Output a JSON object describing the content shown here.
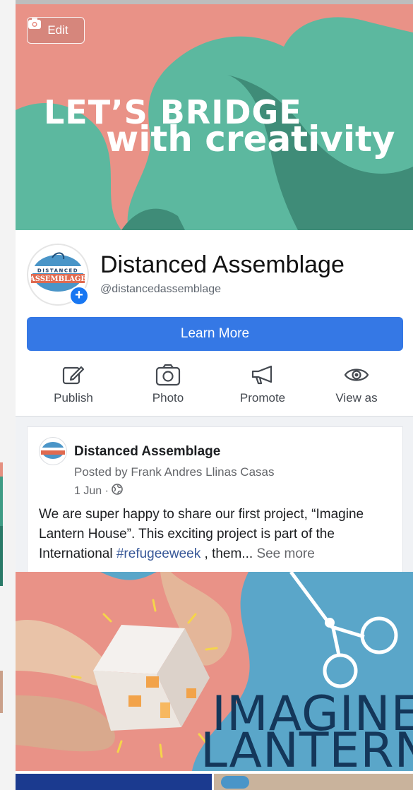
{
  "cover": {
    "edit_label": "Edit",
    "title_line1": "LET’S BRIDGE",
    "title_line2": "with creativity"
  },
  "page": {
    "name": "Distanced Assemblage",
    "handle": "@distancedassemblage",
    "avatar_text": "DISTANCED ASSEMBLAGE"
  },
  "cta": {
    "label": "Learn More"
  },
  "actions": [
    {
      "label": "Publish",
      "icon": "edit-icon"
    },
    {
      "label": "Photo",
      "icon": "camera-icon"
    },
    {
      "label": "Promote",
      "icon": "megaphone-icon"
    },
    {
      "label": "View as",
      "icon": "eye-icon"
    }
  ],
  "post": {
    "author": "Distanced Assemblage",
    "posted_by": "Posted by Frank Andres Llinas Casas",
    "date": "1 Jun ·",
    "text_before": "We are super happy to share our first project, “Imagine Lantern House”. This exciting project is part of the International ",
    "hashtag": "#refugeeweek",
    "text_after": " , them... ",
    "see_more": "See more",
    "image_line1": "IMAGINE",
    "image_line2": "LANTERN"
  },
  "colors": {
    "accent": "#3578e5",
    "cover_pink": "#e99287",
    "cover_teal": "#5cb89f",
    "image_blue": "#5aa6c9"
  }
}
